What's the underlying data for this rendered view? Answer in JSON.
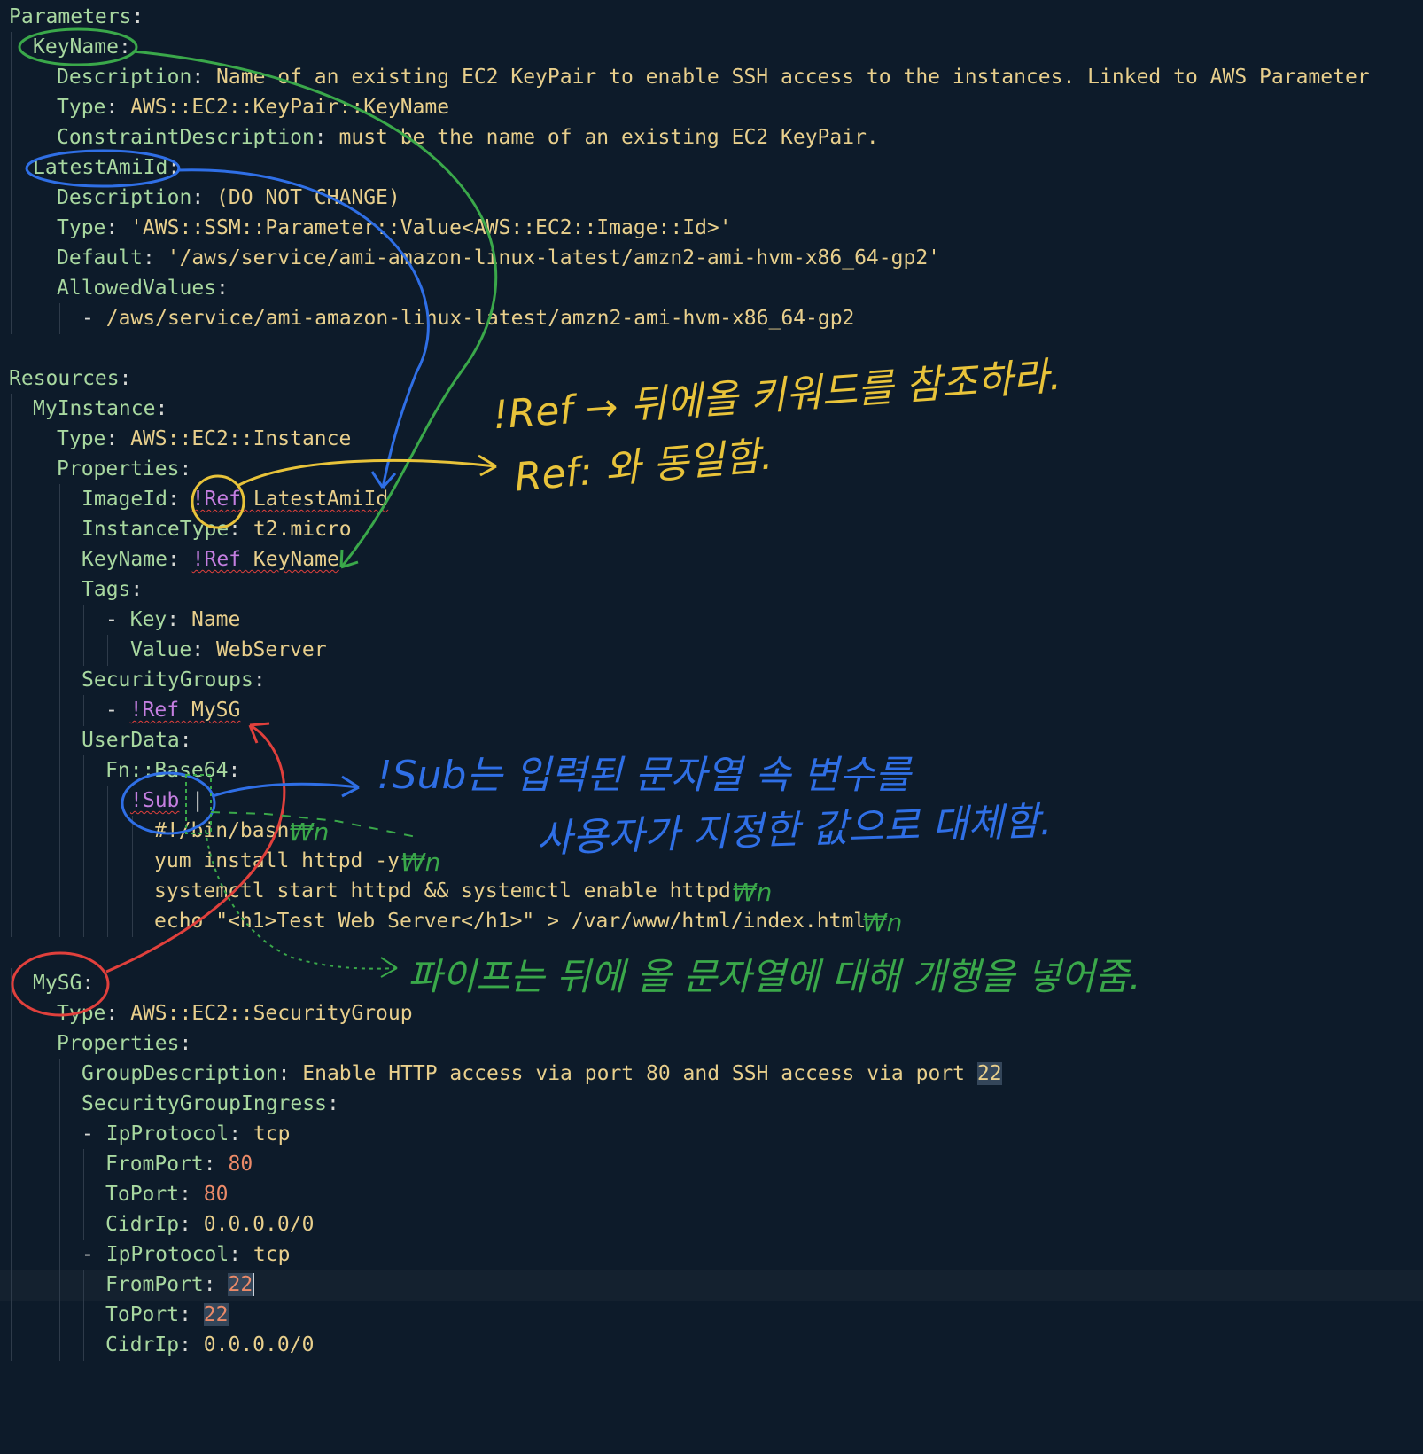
{
  "code": {
    "l01": {
      "key": "Parameters"
    },
    "l02": {
      "key": "KeyName"
    },
    "l03": {
      "key": "Description",
      "value": "Name of an existing EC2 KeyPair to enable SSH access to the instances. Linked to AWS Parameter"
    },
    "l04": {
      "key": "Type",
      "value": "AWS::EC2::KeyPair::KeyName"
    },
    "l05": {
      "key": "ConstraintDescription",
      "value": "must be the name of an existing EC2 KeyPair."
    },
    "l06": {
      "key": "LatestAmiId"
    },
    "l07": {
      "key": "Description",
      "value": "(DO NOT CHANGE)"
    },
    "l08": {
      "key": "Type",
      "value": "'AWS::SSM::Parameter::Value<AWS::EC2::Image::Id>'"
    },
    "l09": {
      "key": "Default",
      "value": "'/aws/service/ami-amazon-linux-latest/amzn2-ami-hvm-x86_64-gp2'"
    },
    "l10": {
      "key": "AllowedValues"
    },
    "l11": {
      "dash": "-",
      "value": "/aws/service/ami-amazon-linux-latest/amzn2-ami-hvm-x86_64-gp2"
    },
    "l13": {
      "key": "Resources"
    },
    "l14": {
      "key": "MyInstance"
    },
    "l15": {
      "key": "Type",
      "value": "AWS::EC2::Instance"
    },
    "l16": {
      "key": "Properties"
    },
    "l17": {
      "key": "ImageId",
      "tag": "!Ref",
      "value": "LatestAmiId"
    },
    "l18": {
      "key": "InstanceType",
      "value": "t2.micro"
    },
    "l19": {
      "key": "KeyName",
      "tag": "!Ref",
      "value": "KeyName"
    },
    "l20": {
      "key": "Tags"
    },
    "l21": {
      "dash": "-",
      "key": "Key",
      "value": "Name"
    },
    "l22": {
      "key": "Value",
      "value": "WebServer"
    },
    "l23": {
      "key": "SecurityGroups"
    },
    "l24": {
      "dash": "-",
      "tag": "!Ref",
      "value": "MySG"
    },
    "l25": {
      "key": "UserData"
    },
    "l26": {
      "key": "Fn::Base64"
    },
    "l27": {
      "tag": "!Sub",
      "value": "|"
    },
    "l28": {
      "value": "#!/bin/bash"
    },
    "l29": {
      "value": "yum install httpd -y"
    },
    "l30": {
      "value": "systemctl start httpd && systemctl enable httpd"
    },
    "l31": {
      "value": "echo \"<h1>Test Web Server</h1>\" > /var/www/html/index.html"
    },
    "l32": {
      "key": "MySG"
    },
    "l33": {
      "key": "Type",
      "value": "AWS::EC2::SecurityGroup"
    },
    "l34": {
      "key": "Properties"
    },
    "l35": {
      "key": "GroupDescription",
      "value": "Enable HTTP access via port 80 and SSH access via port",
      "num": "22"
    },
    "l36": {
      "key": "SecurityGroupIngress"
    },
    "l37": {
      "dash": "-",
      "key": "IpProtocol",
      "value": "tcp"
    },
    "l38": {
      "key": "FromPort",
      "num": "80"
    },
    "l39": {
      "key": "ToPort",
      "num": "80"
    },
    "l40": {
      "key": "CidrIp",
      "value": "0.0.0.0/0"
    },
    "l41": {
      "dash": "-",
      "key": "IpProtocol",
      "value": "tcp"
    },
    "l42": {
      "key": "FromPort",
      "num": "22"
    },
    "l43": {
      "key": "ToPort",
      "num": "22"
    },
    "l44": {
      "key": "CidrIp",
      "value": "0.0.0.0/0"
    }
  },
  "annotations": {
    "ref_line1": "!Ref → 뒤에올 키워드를 참조하라.",
    "ref_line2": "Ref: 와 동일함.",
    "sub_line1": "!Sub는 입력된 문자열 속 변수를",
    "sub_line2": "사용자가 지정한 값으로 대체함.",
    "pipe_note": "파이프는 뒤에 올 문자열에 대해 개행을 넣어줌.",
    "newline_mark": "₩n"
  },
  "colors": {
    "background": "#0d1b2a",
    "key": "#a8d8a0",
    "string": "#e8cf8c",
    "number": "#ec8a68",
    "tag": "#c47ee0",
    "annotation_green": "#3aa84a",
    "annotation_blue": "#2f6fe6",
    "annotation_yellow": "#e8c33a",
    "annotation_red": "#e0403c"
  }
}
